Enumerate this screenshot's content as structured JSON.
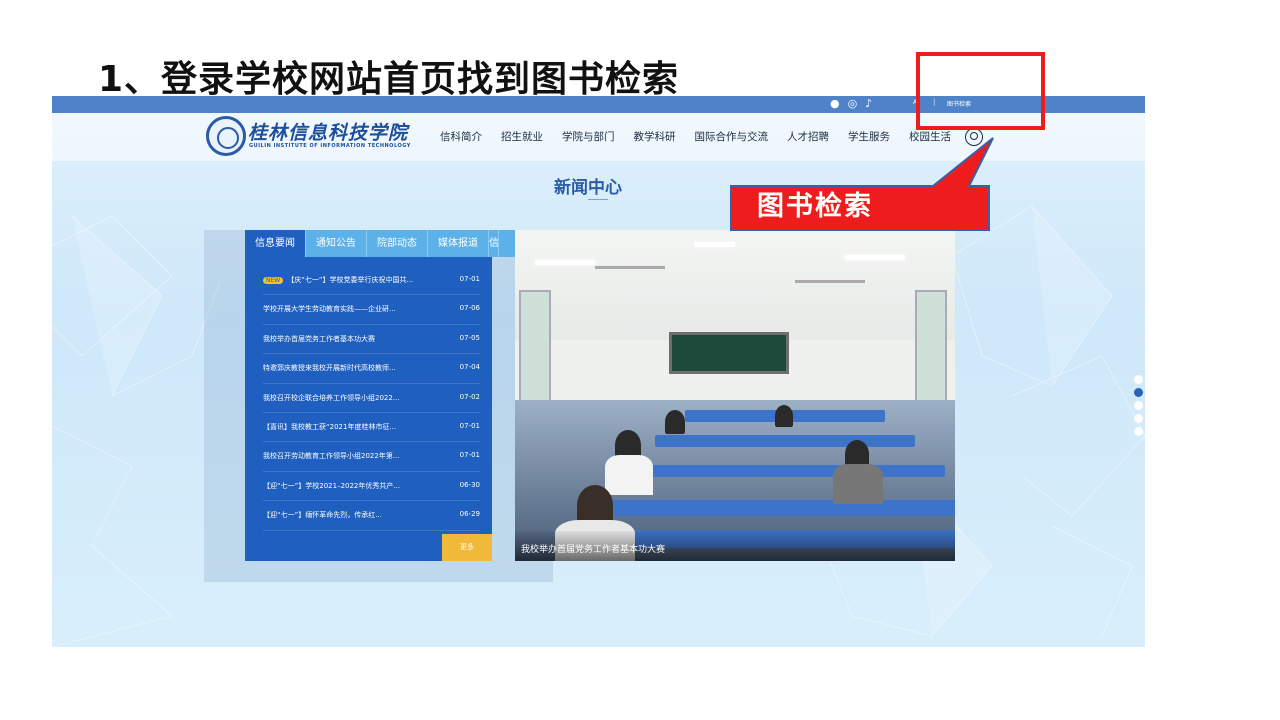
{
  "slide": {
    "title": "1、登录学校网站首页找到图书检索"
  },
  "topbar": {
    "social_icons": [
      "wechat-icon",
      "weibo-icon",
      "tiktok-icon"
    ],
    "link_small": "A",
    "separator": "|",
    "library_search_link": "图书检索",
    "color": "#4f83c9"
  },
  "header": {
    "logo_cn": "桂林信息科技学院",
    "logo_en": "GUILIN INSTITUTE OF INFORMATION TECHNOLOGY",
    "nav": [
      "信科简介",
      "招生就业",
      "学院与部门",
      "教学科研",
      "国际合作与交流",
      "人才招聘",
      "学生服务",
      "校园生活"
    ]
  },
  "news": {
    "section_title": "新闻中心",
    "tabs": [
      "信息要闻",
      "通知公告",
      "院部动态",
      "媒体报道",
      "信"
    ],
    "items": [
      {
        "badge": "NEW",
        "title": "【庆“七一”】学校党委举行庆祝中国共...",
        "date": "07-01"
      },
      {
        "badge": "",
        "title": "学校开展大学生劳动教育实践——企业研...",
        "date": "07-06"
      },
      {
        "badge": "",
        "title": "我校举办首届党务工作者基本功大赛",
        "date": "07-05"
      },
      {
        "badge": "",
        "title": "特邀郭庆教授来我校开展新时代高校教师...",
        "date": "07-04"
      },
      {
        "badge": "",
        "title": "我校召开校企联合培养工作领导小组2022...",
        "date": "07-02"
      },
      {
        "badge": "",
        "title": "【喜讯】我校教工获“2021年度桂林市征...",
        "date": "07-01"
      },
      {
        "badge": "",
        "title": "我校召开劳动教育工作领导小组2022年第...",
        "date": "07-01"
      },
      {
        "badge": "",
        "title": "【迎“七一”】学校2021–2022年优秀共产...",
        "date": "06-30"
      },
      {
        "badge": "",
        "title": "【迎“七一”】缅怀革命先烈，传承红...",
        "date": "06-29"
      }
    ],
    "more_label": "更多",
    "photo_caption": "我校举办首届党务工作者基本功大赛",
    "panel_color": "#1f5fbf",
    "tab_color": "#5bb1e8"
  },
  "carousel": {
    "dot_count": 5,
    "active_index": 1
  },
  "annotation": {
    "callout_label": "图书检索",
    "color": "#ee1c1c"
  }
}
